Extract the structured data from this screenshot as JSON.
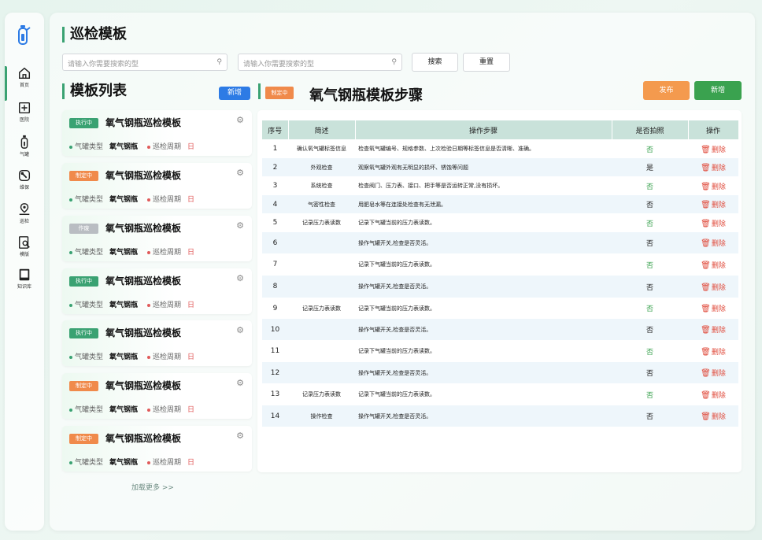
{
  "sidebar": {
    "items": [
      {
        "label": "首页",
        "icon": "home-icon"
      },
      {
        "label": "医院",
        "icon": "hospital-icon"
      },
      {
        "label": "气罐",
        "icon": "gas-tank-icon"
      },
      {
        "label": "维保",
        "icon": "wrench-icon"
      },
      {
        "label": "巡检",
        "icon": "location-icon"
      },
      {
        "label": "模版",
        "icon": "document-search-icon"
      },
      {
        "label": "知识库",
        "icon": "book-icon"
      }
    ]
  },
  "header": {
    "title": "巡检模板"
  },
  "search": {
    "placeholder1": "请输入你需要搜索的型",
    "placeholder2": "请输入你需要搜索的型",
    "search_label": "搜索",
    "reset_label": "重置"
  },
  "list": {
    "title": "模板列表",
    "add_label": "新增",
    "load_more": "加载更多 >>",
    "cards": [
      {
        "status": "执行中",
        "status_type": "exec",
        "title": "氧气钢瓶巡检模板",
        "type_label": "气罐类型",
        "type_value": "氧气钢瓶",
        "period_label": "巡检周期",
        "period_value": "日"
      },
      {
        "status": "制定中",
        "status_type": "draft",
        "title": "氧气钢瓶巡检模板",
        "type_label": "气罐类型",
        "type_value": "氧气钢瓶",
        "period_label": "巡检周期",
        "period_value": "日"
      },
      {
        "status": "作废",
        "status_type": "void",
        "title": "氧气钢瓶巡检模板",
        "type_label": "气罐类型",
        "type_value": "氧气钢瓶",
        "period_label": "巡检周期",
        "period_value": "日"
      },
      {
        "status": "执行中",
        "status_type": "exec",
        "title": "氧气钢瓶巡检模板",
        "type_label": "气罐类型",
        "type_value": "氧气钢瓶",
        "period_label": "巡检周期",
        "period_value": "日"
      },
      {
        "status": "执行中",
        "status_type": "exec",
        "title": "氧气钢瓶巡检模板",
        "type_label": "气罐类型",
        "type_value": "氧气钢瓶",
        "period_label": "巡检周期",
        "period_value": "日"
      },
      {
        "status": "制定中",
        "status_type": "draft",
        "title": "氧气钢瓶巡检模板",
        "type_label": "气罐类型",
        "type_value": "氧气钢瓶",
        "period_label": "巡检周期",
        "period_value": "日"
      },
      {
        "status": "制定中",
        "status_type": "draft",
        "title": "氧气钢瓶巡检模板",
        "type_label": "气罐类型",
        "type_value": "氧气钢瓶",
        "period_label": "巡检周期",
        "period_value": "日"
      }
    ]
  },
  "steps": {
    "status": "制定中",
    "title": "氧气钢瓶模板步骤",
    "publish_label": "发布",
    "add_label": "新增",
    "columns": [
      "序号",
      "简述",
      "操作步骤",
      "是否拍照",
      "操作"
    ],
    "delete_label": "删除",
    "rows": [
      {
        "no": "1",
        "summary": "确认氧气罐标签信息",
        "step": "检查氧气罐编号、规格参数、上次检验日期等标签信息是否清晰、准确。",
        "photo": "否"
      },
      {
        "no": "2",
        "summary": "外观检查",
        "step": "观察氧气罐外观有无明显的损坏、锈蚀等问题",
        "photo": "是"
      },
      {
        "no": "3",
        "summary": "系统检查",
        "step": "检查阀门、压力表、接口、把手等是否运转正常,没有损坏。",
        "photo": "否"
      },
      {
        "no": "4",
        "summary": "气密性检查",
        "step": "用肥皂水等在连接处检查有无泄漏。",
        "photo": "否"
      },
      {
        "no": "5",
        "summary": "记录压力表读数",
        "step": "记录下气罐当前的压力表读数。",
        "photo": "否"
      },
      {
        "no": "6",
        "summary": "",
        "step": "操作气罐开关,检查是否灵活。",
        "photo": "否"
      },
      {
        "no": "7",
        "summary": "",
        "step": "记录下气罐当前的压力表读数。",
        "photo": "否"
      },
      {
        "no": "8",
        "summary": "",
        "step": "操作气罐开关,检查是否灵活。",
        "photo": "否"
      },
      {
        "no": "9",
        "summary": "记录压力表读数",
        "step": "记录下气罐当前的压力表读数。",
        "photo": "否"
      },
      {
        "no": "10",
        "summary": "",
        "step": "操作气罐开关,检查是否灵活。",
        "photo": "否"
      },
      {
        "no": "11",
        "summary": "",
        "step": "记录下气罐当前的压力表读数。",
        "photo": "否"
      },
      {
        "no": "12",
        "summary": "",
        "step": "操作气罐开关,检查是否灵活。",
        "photo": "否"
      },
      {
        "no": "13",
        "summary": "记录压力表读数",
        "step": "记录下气罐当前的压力表读数。",
        "photo": "否"
      },
      {
        "no": "14",
        "summary": "操作检查",
        "step": "操作气罐开关,检查是否灵活。",
        "photo": "否"
      }
    ]
  },
  "colors": {
    "accent": "#3aa272",
    "draft": "#f08a4b",
    "publish": "#f49a4e",
    "add": "#3aa24f",
    "primary": "#2d7be5",
    "danger": "#e04b3c"
  }
}
